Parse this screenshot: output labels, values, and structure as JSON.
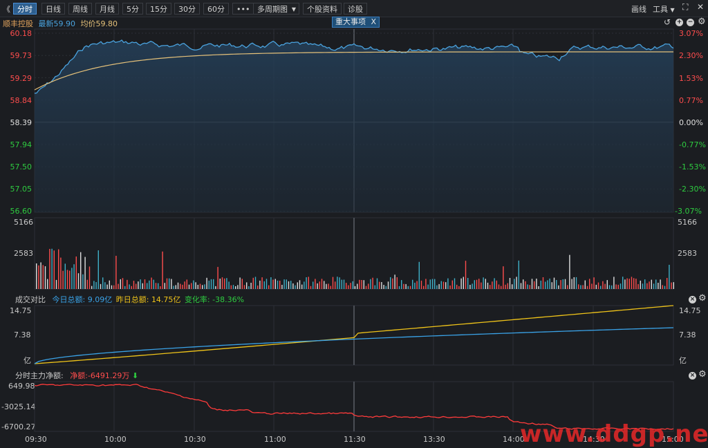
{
  "toolbar": {
    "back": "《",
    "tabs": [
      "分时",
      "日线",
      "周线",
      "月线",
      "5分",
      "15分",
      "30分",
      "60分"
    ],
    "more": "•••",
    "multi_period": "多周期图",
    "stock_info": "个股资料",
    "diagnose": "诊股",
    "draw": "画线",
    "tools": "工具",
    "expand": "⛶"
  },
  "header": {
    "name": "顺丰控股",
    "latest_label": "最新",
    "latest": "59.90",
    "avg_label": "均价",
    "avg": "59.80",
    "event_tag": "重大事项",
    "event_close": "X"
  },
  "colors": {
    "up": "#ff4d4d",
    "down": "#2ecc40",
    "price_line": "#4aa3df",
    "avg_line": "#e6c27a",
    "today": "#3aa3e8",
    "yesterday": "#f0c419"
  },
  "price_axis": {
    "left": [
      "60.18",
      "59.73",
      "59.29",
      "58.84",
      "58.39",
      "57.94",
      "57.50",
      "57.05",
      "56.60"
    ],
    "right": [
      "3.07%",
      "2.30%",
      "1.53%",
      "0.77%",
      "0.00%",
      "-0.77%",
      "-1.53%",
      "-2.30%",
      "-3.07%"
    ]
  },
  "volume_axis": {
    "top": "5166",
    "mid": "2583"
  },
  "compare_panel": {
    "title": "成交对比",
    "today_label": "今日总额:",
    "today_value": "9.09亿",
    "yesterday_label": "昨日总额:",
    "yesterday_value": "14.75亿",
    "change_label": "变化率:",
    "change_value": "-38.36%",
    "axis_top": "14.75",
    "axis_mid": "7.38",
    "axis_unit": "亿"
  },
  "flow_panel": {
    "title": "分时主力净额:",
    "net_label": "净额:",
    "net_value": "-6491.29万",
    "net_arrow": "⬇",
    "axis": [
      "649.98",
      "-3025.14",
      "-6700.27"
    ]
  },
  "time_axis": [
    "09:30",
    "10:00",
    "10:30",
    "11:00",
    "11:30",
    "13:30",
    "14:00",
    "14:30",
    "15:00"
  ],
  "watermark": "www.ddgp.net"
}
